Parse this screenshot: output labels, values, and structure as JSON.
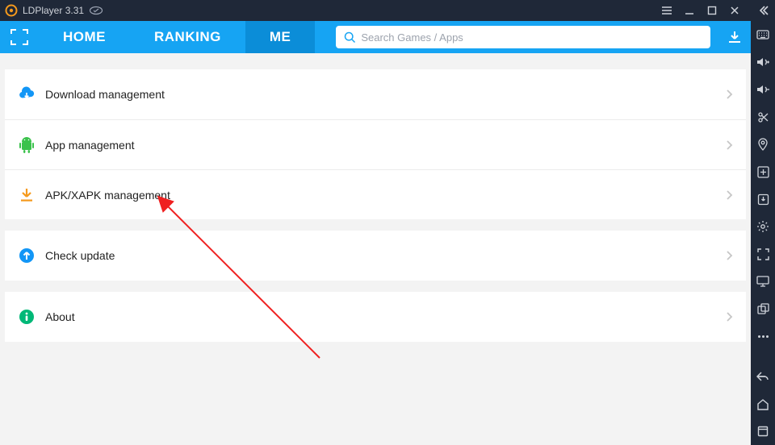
{
  "titlebar": {
    "title": "LDPlayer 3.31"
  },
  "header": {
    "tabs": {
      "home": "HOME",
      "ranking": "RANKING",
      "me": "ME"
    },
    "active_tab": "me",
    "search_placeholder": "Search Games / Apps"
  },
  "menu": {
    "download": "Download management",
    "app": "App management",
    "apk": "APK/XAPK management",
    "check": "Check update",
    "about": "About"
  },
  "side_icons": {
    "collapse": "collapse",
    "keyboard": "keyboard",
    "vol_up": "volume-up",
    "vol_down": "volume-down",
    "cut": "scissors",
    "location": "location",
    "add": "add-box",
    "apk": "apk-install",
    "settings": "settings",
    "fullscreen": "fullscreen",
    "monitor": "monitor",
    "multi": "multi-window",
    "more": "more",
    "back": "back",
    "home": "home",
    "history": "recent"
  }
}
